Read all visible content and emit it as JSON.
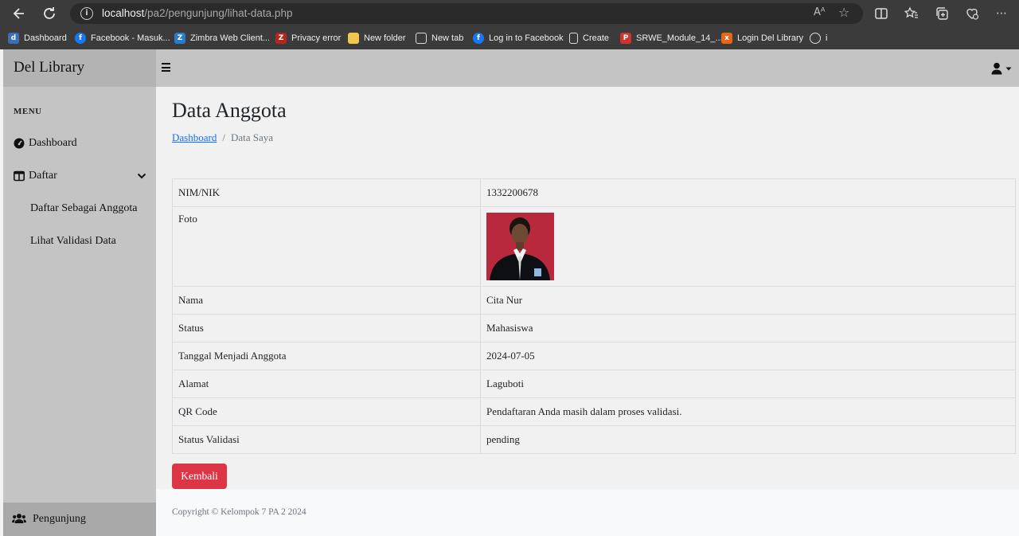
{
  "browser": {
    "url_host": "localhost",
    "url_path": "/pa2/pengunjung/lihat-data.php",
    "reader_label": "Aᴬ",
    "bookmarks": [
      {
        "label": "Dashboard",
        "icon": "del-logo-icon",
        "color": "#3a6fb5"
      },
      {
        "label": "Facebook - Masuk...",
        "icon": "facebook-icon",
        "color": "#1877f2"
      },
      {
        "label": "Zimbra Web Client...",
        "icon": "zimbra-icon",
        "color": "#2a7ccb"
      },
      {
        "label": "Privacy error",
        "icon": "zimbra-error-icon",
        "color": "#b3261e"
      },
      {
        "label": "New folder",
        "icon": "folder-icon",
        "color": "#f2c64b"
      },
      {
        "label": "New tab",
        "icon": "new-tab-icon",
        "color": "#3b3b3b"
      },
      {
        "label": "Log in to Facebook",
        "icon": "facebook-icon",
        "color": "#1877f2"
      },
      {
        "label": "Create",
        "icon": "page-icon",
        "color": "#3b3b3b"
      },
      {
        "label": "SRWE_Module_14_...",
        "icon": "pdf-icon",
        "color": "#d0342c"
      },
      {
        "label": "Login Del Library",
        "icon": "xampp-icon",
        "color": "#e8661a"
      },
      {
        "label": "i",
        "icon": "openai-icon",
        "color": "#3b3b3b"
      }
    ]
  },
  "sidebar": {
    "brand": "Del Library",
    "menu_heading": "MENU",
    "items": [
      {
        "label": "Dashboard",
        "icon": "tachometer-icon"
      },
      {
        "label": "Daftar",
        "icon": "table-columns-icon"
      }
    ],
    "sub_items": [
      {
        "label": "Daftar Sebagai Anggota"
      },
      {
        "label": "Lihat Validasi Data"
      }
    ],
    "footer_label": "Pengunjung",
    "footer_icon": "users-icon"
  },
  "page": {
    "title": "Data Anggota",
    "breadcrumb": {
      "link": "Dashboard",
      "separator": "/",
      "current": "Data Saya"
    }
  },
  "table": {
    "rows": [
      {
        "key": "NIM/NIK",
        "value": "1332200678"
      },
      {
        "key": "Foto",
        "value": ""
      },
      {
        "key": "Nama",
        "value": "Cita Nur"
      },
      {
        "key": "Status",
        "value": "Mahasiswa"
      },
      {
        "key": "Tanggal Menjadi Anggota",
        "value": "2024-07-05"
      },
      {
        "key": "Alamat",
        "value": "Laguboti"
      },
      {
        "key": "QR Code",
        "value": "Pendaftaran Anda masih dalam proses validasi."
      },
      {
        "key": "Status Validasi",
        "value": "pending"
      }
    ]
  },
  "actions": {
    "back_label": "Kembali"
  },
  "footer": {
    "copyright": "Copyright © Kelompok 7 PA 2 2024"
  },
  "colors": {
    "danger": "#dc3545",
    "link": "#0d6efd",
    "sidebar": "#c4c4c4"
  }
}
